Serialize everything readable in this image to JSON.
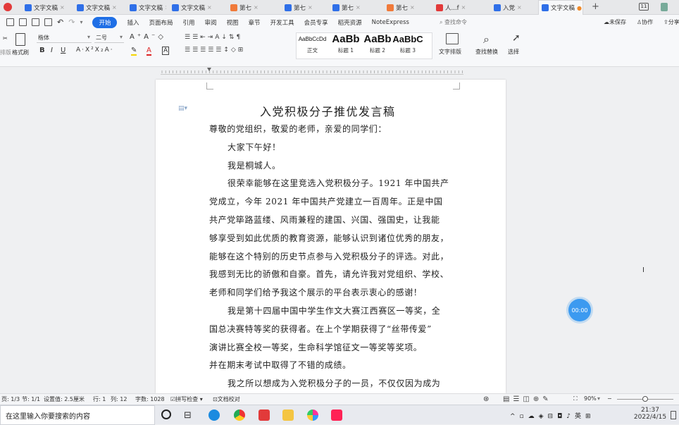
{
  "tabs": [
    {
      "label": "文字文稿",
      "color": "#2f6fe8"
    },
    {
      "label": "文字文稿",
      "color": "#2f6fe8"
    },
    {
      "label": "文字文稿",
      "color": "#2f6fe8"
    },
    {
      "label": "文字文稿",
      "color": "#2f6fe8"
    },
    {
      "label": "第七",
      "color": "#f07a3a"
    },
    {
      "label": "第七",
      "color": "#2f6fe8"
    },
    {
      "label": "第七",
      "color": "#2f6fe8"
    },
    {
      "label": "第七",
      "color": "#f07a3a"
    },
    {
      "label": "人...f",
      "color": "#e23a3a"
    },
    {
      "label": "入党",
      "color": "#2f6fe8"
    },
    {
      "label": "文字文稿",
      "color": "#2f6fe8",
      "active": true
    }
  ],
  "new_tab": "+",
  "window_badge": "11",
  "menu": {
    "items": [
      "开始",
      "插入",
      "页面布局",
      "引用",
      "审阅",
      "视图",
      "章节",
      "开发工具",
      "会员专享",
      "稻壳资源",
      "NoteExpress"
    ],
    "search": "查找命令",
    "unsaved": "未保存",
    "collab": "协作",
    "share": "分享"
  },
  "ribbon": {
    "format_painter": "格式刷",
    "paste_icon": "paste-icon",
    "font_name": "楷体",
    "font_size": "二号",
    "styles": [
      {
        "preview": "AaBbCcDd",
        "label": "正文"
      },
      {
        "preview": "AaBb",
        "label": "标题 1"
      },
      {
        "preview": "AaBb",
        "label": "标题 2"
      },
      {
        "preview": "AaBbC",
        "label": "标题 3"
      }
    ],
    "text_layout": "文字排版",
    "find_replace": "查找替换",
    "select": "选择"
  },
  "document": {
    "title": "入党积极分子推优发言稿",
    "lines": [
      "尊敬的党组织，敬爱的老师，亲爱的同学们：",
      "大家下午好！",
      "我是桐城人。",
      "很荣幸能够在这里竞选入党积极分子。1921 年中国共产",
      "党成立，今年 2021 年中国共产党建立一百周年。正是中国",
      "共产党筚路蓝缕、风雨兼程的建国、兴国、强国史，让我能",
      "够享受到如此优质的教育资源，能够认识到诸位优秀的朋友，",
      "能够在这个特别的历史节点参与入党积极分子的评选。对此，",
      "我感到无比的骄傲和自豪。首先，请允许我对党组织、学校、",
      "老师和同学们给予我这个展示的平台表示衷心的感谢！",
      "我是第十四届中国中学生作文大赛江西赛区一等奖，全",
      "国总决赛特等奖的获得者。在上个学期获得了“丝带传爱”",
      "演讲比赛全校一等奖，生命科学馆征文一等奖等奖项。",
      "并在期末考试中取得了不错的成绩。",
      "我之所以想成为入党积极分子的一员，不仅仅因为成为"
    ]
  },
  "timer": "00:00",
  "status": {
    "page": "页: 1/3",
    "section": "节: 1/1",
    "setting": "设置值: 2.5厘米",
    "row": "行: 1",
    "col": "列: 12",
    "words": "字数: 1028",
    "spell": "拼写检查",
    "proof": "文档校对",
    "zoom": "90%",
    "zoom_level": 0.5
  },
  "taskbar": {
    "search_placeholder": "在这里输入你要搜索的内容",
    "time": "21:37",
    "date": "2022/4/15"
  }
}
